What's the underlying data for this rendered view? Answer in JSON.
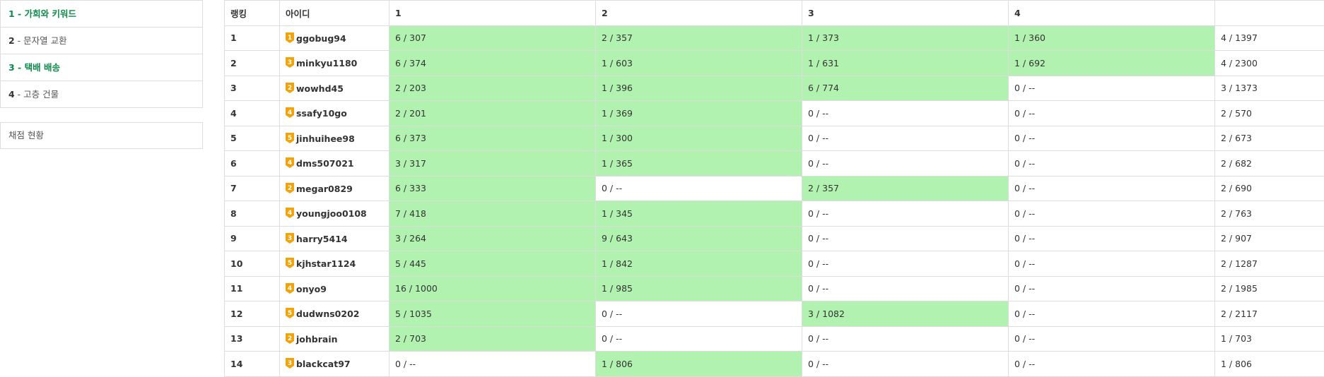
{
  "sidebar": {
    "menu": [
      {
        "num": "1",
        "title": "가희와 키워드",
        "active": true
      },
      {
        "num": "2",
        "title": "문자열 교환",
        "active": false
      },
      {
        "num": "3",
        "title": "택배 배송",
        "active": true
      },
      {
        "num": "4",
        "title": "고층 건물",
        "active": false
      }
    ],
    "status_label": "채점 현황"
  },
  "table": {
    "headers": [
      "랭킹",
      "아이디",
      "1",
      "2",
      "3",
      "4",
      ""
    ],
    "rows": [
      {
        "rank": "1",
        "tier": "1",
        "id": "ggobug94",
        "p": [
          {
            "t": "6 / 307",
            "ac": true
          },
          {
            "t": "2 / 357",
            "ac": true
          },
          {
            "t": "1 / 373",
            "ac": true
          },
          {
            "t": "1 / 360",
            "ac": true
          }
        ],
        "total": "4 / 1397"
      },
      {
        "rank": "2",
        "tier": "3",
        "id": "minkyu1180",
        "p": [
          {
            "t": "6 / 374",
            "ac": true
          },
          {
            "t": "1 / 603",
            "ac": true
          },
          {
            "t": "1 / 631",
            "ac": true
          },
          {
            "t": "1 / 692",
            "ac": true
          }
        ],
        "total": "4 / 2300"
      },
      {
        "rank": "3",
        "tier": "2",
        "id": "wowhd45",
        "p": [
          {
            "t": "2 / 203",
            "ac": true
          },
          {
            "t": "1 / 396",
            "ac": true
          },
          {
            "t": "6 / 774",
            "ac": true
          },
          {
            "t": "0 / --",
            "ac": false
          }
        ],
        "total": "3 / 1373"
      },
      {
        "rank": "4",
        "tier": "4",
        "id": "ssafy10go",
        "p": [
          {
            "t": "2 / 201",
            "ac": true
          },
          {
            "t": "1 / 369",
            "ac": true
          },
          {
            "t": "0 / --",
            "ac": false
          },
          {
            "t": "0 / --",
            "ac": false
          }
        ],
        "total": "2 / 570"
      },
      {
        "rank": "5",
        "tier": "5",
        "id": "jinhuihee98",
        "p": [
          {
            "t": "6 / 373",
            "ac": true
          },
          {
            "t": "1 / 300",
            "ac": true
          },
          {
            "t": "0 / --",
            "ac": false
          },
          {
            "t": "0 / --",
            "ac": false
          }
        ],
        "total": "2 / 673"
      },
      {
        "rank": "6",
        "tier": "4",
        "id": "dms507021",
        "p": [
          {
            "t": "3 / 317",
            "ac": true
          },
          {
            "t": "1 / 365",
            "ac": true
          },
          {
            "t": "0 / --",
            "ac": false
          },
          {
            "t": "0 / --",
            "ac": false
          }
        ],
        "total": "2 / 682"
      },
      {
        "rank": "7",
        "tier": "2",
        "id": "megar0829",
        "p": [
          {
            "t": "6 / 333",
            "ac": true
          },
          {
            "t": "0 / --",
            "ac": false
          },
          {
            "t": "2 / 357",
            "ac": true
          },
          {
            "t": "0 / --",
            "ac": false
          }
        ],
        "total": "2 / 690"
      },
      {
        "rank": "8",
        "tier": "4",
        "id": "youngjoo0108",
        "p": [
          {
            "t": "7 / 418",
            "ac": true
          },
          {
            "t": "1 / 345",
            "ac": true
          },
          {
            "t": "0 / --",
            "ac": false
          },
          {
            "t": "0 / --",
            "ac": false
          }
        ],
        "total": "2 / 763"
      },
      {
        "rank": "9",
        "tier": "3",
        "id": "harry5414",
        "p": [
          {
            "t": "3 / 264",
            "ac": true
          },
          {
            "t": "9 / 643",
            "ac": true
          },
          {
            "t": "0 / --",
            "ac": false
          },
          {
            "t": "0 / --",
            "ac": false
          }
        ],
        "total": "2 / 907"
      },
      {
        "rank": "10",
        "tier": "5",
        "id": "kjhstar1124",
        "p": [
          {
            "t": "5 / 445",
            "ac": true
          },
          {
            "t": "1 / 842",
            "ac": true
          },
          {
            "t": "0 / --",
            "ac": false
          },
          {
            "t": "0 / --",
            "ac": false
          }
        ],
        "total": "2 / 1287"
      },
      {
        "rank": "11",
        "tier": "4",
        "id": "onyo9",
        "p": [
          {
            "t": "16 / 1000",
            "ac": true
          },
          {
            "t": "1 / 985",
            "ac": true
          },
          {
            "t": "0 / --",
            "ac": false
          },
          {
            "t": "0 / --",
            "ac": false
          }
        ],
        "total": "2 / 1985"
      },
      {
        "rank": "12",
        "tier": "5",
        "id": "dudwns0202",
        "p": [
          {
            "t": "5 / 1035",
            "ac": true
          },
          {
            "t": "0 / --",
            "ac": false
          },
          {
            "t": "3 / 1082",
            "ac": true
          },
          {
            "t": "0 / --",
            "ac": false
          }
        ],
        "total": "2 / 2117"
      },
      {
        "rank": "13",
        "tier": "2",
        "id": "johbrain",
        "p": [
          {
            "t": "2 / 703",
            "ac": true
          },
          {
            "t": "0 / --",
            "ac": false
          },
          {
            "t": "0 / --",
            "ac": false
          },
          {
            "t": "0 / --",
            "ac": false
          }
        ],
        "total": "1 / 703"
      },
      {
        "rank": "14",
        "tier": "3",
        "id": "blackcat97",
        "p": [
          {
            "t": "0 / --",
            "ac": false
          },
          {
            "t": "1 / 806",
            "ac": true
          },
          {
            "t": "0 / --",
            "ac": false
          },
          {
            "t": "0 / --",
            "ac": false
          }
        ],
        "total": "1 / 806"
      }
    ]
  },
  "colors": {
    "accepted_cell": "#b2f2b0",
    "active_menu": "#0b8a4a",
    "tier_badge": "#f0a30a",
    "border": "#dddddd"
  },
  "icons": {
    "tier_badge": "gold-tier-badge-icon"
  }
}
